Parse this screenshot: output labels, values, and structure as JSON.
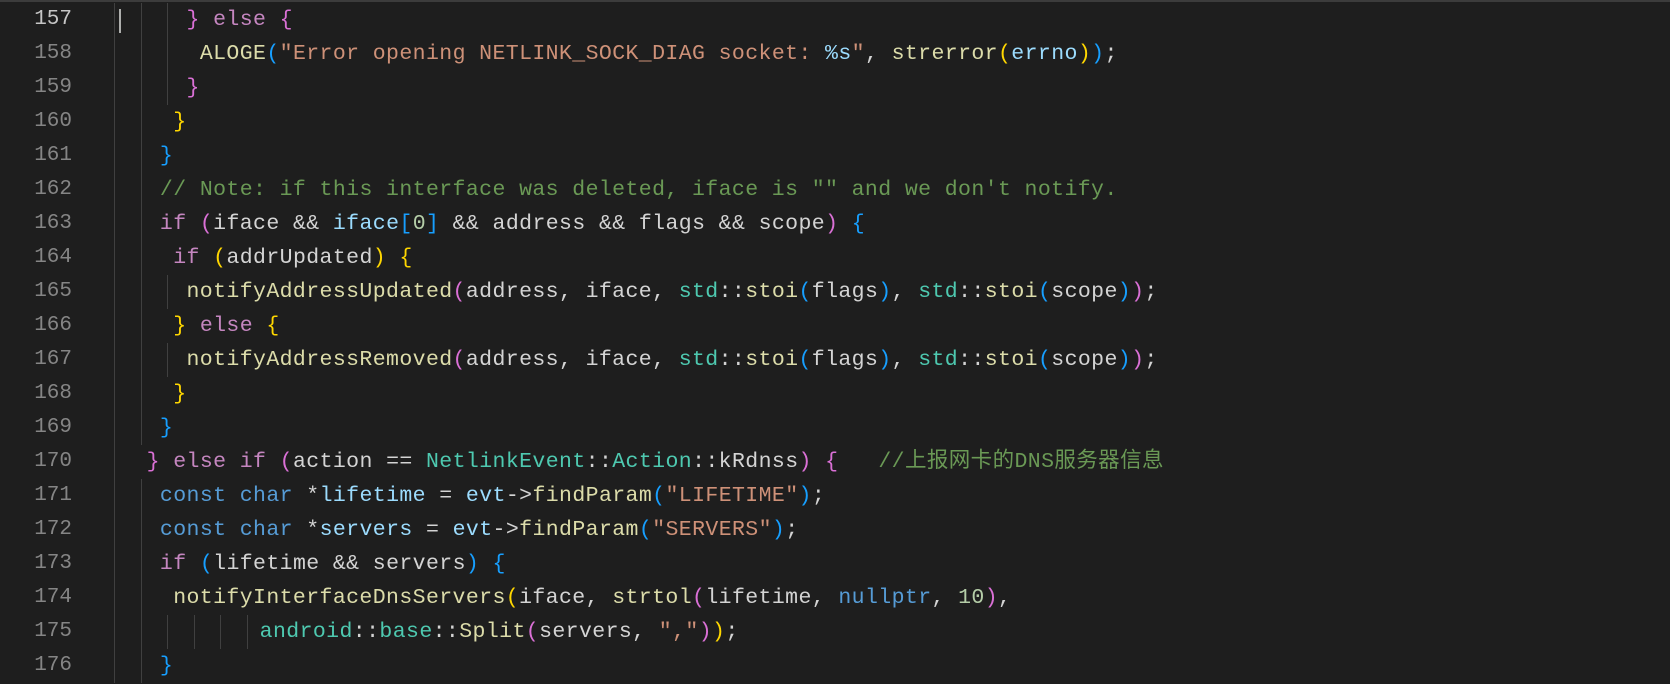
{
  "editor": {
    "language": "cpp",
    "theme": "dark",
    "active_line": "157",
    "colors": {
      "background": "#1e1e1e",
      "keyword": "#569cd6",
      "control": "#c586c0",
      "function": "#dcdcaa",
      "string": "#ce9178",
      "type": "#4ec9b0",
      "comment": "#6a9955",
      "number": "#b5cea8",
      "bracket_gold": "#ffd700",
      "bracket_orchid": "#da70d6",
      "bracket_blue": "#179fff"
    },
    "lines": [
      {
        "num": "157",
        "indent": 10,
        "tokens": [
          [
            "b2",
            "}"
          ],
          [
            "pl",
            " "
          ],
          [
            "ctl",
            "else"
          ],
          [
            "pl",
            " "
          ],
          [
            "b2",
            "{"
          ]
        ]
      },
      {
        "num": "158",
        "indent": 12,
        "tokens": [
          [
            "fn",
            "ALOGE"
          ],
          [
            "b3",
            "("
          ],
          [
            "str",
            "\"Error opening NETLINK_SOCK_DIAG socket: "
          ],
          [
            "esc",
            "%s"
          ],
          [
            "str",
            "\""
          ],
          [
            "pl",
            ", "
          ],
          [
            "fn",
            "strerror"
          ],
          [
            "b1",
            "("
          ],
          [
            "var",
            "errno"
          ],
          [
            "b1",
            ")"
          ],
          [
            "b3",
            ")"
          ],
          [
            "pl",
            ";"
          ]
        ]
      },
      {
        "num": "159",
        "indent": 10,
        "tokens": [
          [
            "b2",
            "}"
          ]
        ]
      },
      {
        "num": "160",
        "indent": 8,
        "tokens": [
          [
            "b1",
            "}"
          ]
        ]
      },
      {
        "num": "161",
        "indent": 6,
        "tokens": [
          [
            "b3",
            "}"
          ]
        ]
      },
      {
        "num": "162",
        "indent": 6,
        "tokens": [
          [
            "cm",
            "// Note: if this interface was deleted, iface is \"\" and we don't notify."
          ]
        ]
      },
      {
        "num": "163",
        "indent": 6,
        "tokens": [
          [
            "ctl",
            "if"
          ],
          [
            "pl",
            " "
          ],
          [
            "b2",
            "("
          ],
          [
            "pl",
            "iface && "
          ],
          [
            "var",
            "iface"
          ],
          [
            "b3",
            "["
          ],
          [
            "num",
            "0"
          ],
          [
            "b3",
            "]"
          ],
          [
            "pl",
            " && address && flags && scope"
          ],
          [
            "b2",
            ")"
          ],
          [
            "pl",
            " "
          ],
          [
            "b3",
            "{"
          ]
        ]
      },
      {
        "num": "164",
        "indent": 8,
        "tokens": [
          [
            "ctl",
            "if"
          ],
          [
            "pl",
            " "
          ],
          [
            "b1",
            "("
          ],
          [
            "pl",
            "addrUpdated"
          ],
          [
            "b1",
            ")"
          ],
          [
            "pl",
            " "
          ],
          [
            "b1",
            "{"
          ]
        ]
      },
      {
        "num": "165",
        "indent": 10,
        "tokens": [
          [
            "fn",
            "notifyAddressUpdated"
          ],
          [
            "b2",
            "("
          ],
          [
            "pl",
            "address, iface, "
          ],
          [
            "ty",
            "std"
          ],
          [
            "pl",
            "::"
          ],
          [
            "fn",
            "stoi"
          ],
          [
            "b3",
            "("
          ],
          [
            "pl",
            "flags"
          ],
          [
            "b3",
            ")"
          ],
          [
            "pl",
            ", "
          ],
          [
            "ty",
            "std"
          ],
          [
            "pl",
            "::"
          ],
          [
            "fn",
            "stoi"
          ],
          [
            "b3",
            "("
          ],
          [
            "pl",
            "scope"
          ],
          [
            "b3",
            ")"
          ],
          [
            "b2",
            ")"
          ],
          [
            "pl",
            ";"
          ]
        ]
      },
      {
        "num": "166",
        "indent": 8,
        "tokens": [
          [
            "b1",
            "}"
          ],
          [
            "pl",
            " "
          ],
          [
            "ctl",
            "else"
          ],
          [
            "pl",
            " "
          ],
          [
            "b1",
            "{"
          ]
        ]
      },
      {
        "num": "167",
        "indent": 10,
        "tokens": [
          [
            "fn",
            "notifyAddressRemoved"
          ],
          [
            "b2",
            "("
          ],
          [
            "pl",
            "address, iface, "
          ],
          [
            "ty",
            "std"
          ],
          [
            "pl",
            "::"
          ],
          [
            "fn",
            "stoi"
          ],
          [
            "b3",
            "("
          ],
          [
            "pl",
            "flags"
          ],
          [
            "b3",
            ")"
          ],
          [
            "pl",
            ", "
          ],
          [
            "ty",
            "std"
          ],
          [
            "pl",
            "::"
          ],
          [
            "fn",
            "stoi"
          ],
          [
            "b3",
            "("
          ],
          [
            "pl",
            "scope"
          ],
          [
            "b3",
            ")"
          ],
          [
            "b2",
            ")"
          ],
          [
            "pl",
            ";"
          ]
        ]
      },
      {
        "num": "168",
        "indent": 8,
        "tokens": [
          [
            "b1",
            "}"
          ]
        ]
      },
      {
        "num": "169",
        "indent": 6,
        "tokens": [
          [
            "b3",
            "}"
          ]
        ]
      },
      {
        "num": "170",
        "indent": 4,
        "tokens": [
          [
            "b2",
            "}"
          ],
          [
            "pl",
            " "
          ],
          [
            "ctl",
            "else if"
          ],
          [
            "pl",
            " "
          ],
          [
            "b2",
            "("
          ],
          [
            "pl",
            "action == "
          ],
          [
            "ty",
            "NetlinkEvent"
          ],
          [
            "pl",
            "::"
          ],
          [
            "ty",
            "Action"
          ],
          [
            "pl",
            "::kRdnss"
          ],
          [
            "b2",
            ")"
          ],
          [
            "pl",
            " "
          ],
          [
            "b2",
            "{"
          ],
          [
            "pl",
            "   "
          ],
          [
            "cm",
            "//上报网卡的DNS服务器信息"
          ]
        ]
      },
      {
        "num": "171",
        "indent": 6,
        "tokens": [
          [
            "kw",
            "const"
          ],
          [
            "pl",
            " "
          ],
          [
            "kw",
            "char"
          ],
          [
            "pl",
            " *"
          ],
          [
            "var",
            "lifetime"
          ],
          [
            "pl",
            " = "
          ],
          [
            "var",
            "evt"
          ],
          [
            "pl",
            "->"
          ],
          [
            "fn",
            "findParam"
          ],
          [
            "b3",
            "("
          ],
          [
            "str",
            "\"LIFETIME\""
          ],
          [
            "b3",
            ")"
          ],
          [
            "pl",
            ";"
          ]
        ]
      },
      {
        "num": "172",
        "indent": 6,
        "tokens": [
          [
            "kw",
            "const"
          ],
          [
            "pl",
            " "
          ],
          [
            "kw",
            "char"
          ],
          [
            "pl",
            " *"
          ],
          [
            "var",
            "servers"
          ],
          [
            "pl",
            " = "
          ],
          [
            "var",
            "evt"
          ],
          [
            "pl",
            "->"
          ],
          [
            "fn",
            "findParam"
          ],
          [
            "b3",
            "("
          ],
          [
            "str",
            "\"SERVERS\""
          ],
          [
            "b3",
            ")"
          ],
          [
            "pl",
            ";"
          ]
        ]
      },
      {
        "num": "173",
        "indent": 6,
        "tokens": [
          [
            "ctl",
            "if"
          ],
          [
            "pl",
            " "
          ],
          [
            "b3",
            "("
          ],
          [
            "pl",
            "lifetime && servers"
          ],
          [
            "b3",
            ")"
          ],
          [
            "pl",
            " "
          ],
          [
            "b3",
            "{"
          ]
        ]
      },
      {
        "num": "174",
        "indent": 8,
        "tokens": [
          [
            "fn",
            "notifyInterfaceDnsServers"
          ],
          [
            "b1",
            "("
          ],
          [
            "pl",
            "iface, "
          ],
          [
            "fn",
            "strtol"
          ],
          [
            "b2",
            "("
          ],
          [
            "pl",
            "lifetime, "
          ],
          [
            "kw",
            "nullptr"
          ],
          [
            "pl",
            ", "
          ],
          [
            "num",
            "10"
          ],
          [
            "b2",
            ")"
          ],
          [
            "pl",
            ","
          ]
        ]
      },
      {
        "num": "175",
        "indent": 21,
        "tokens": [
          [
            "ty",
            "android"
          ],
          [
            "pl",
            "::"
          ],
          [
            "ty",
            "base"
          ],
          [
            "pl",
            "::"
          ],
          [
            "fn",
            "Split"
          ],
          [
            "b2",
            "("
          ],
          [
            "pl",
            "servers, "
          ],
          [
            "str",
            "\",\""
          ],
          [
            "b2",
            ")"
          ],
          [
            "b1",
            ")"
          ],
          [
            "pl",
            ";"
          ]
        ]
      },
      {
        "num": "176",
        "indent": 6,
        "tokens": [
          [
            "b3",
            "}"
          ]
        ]
      }
    ]
  }
}
